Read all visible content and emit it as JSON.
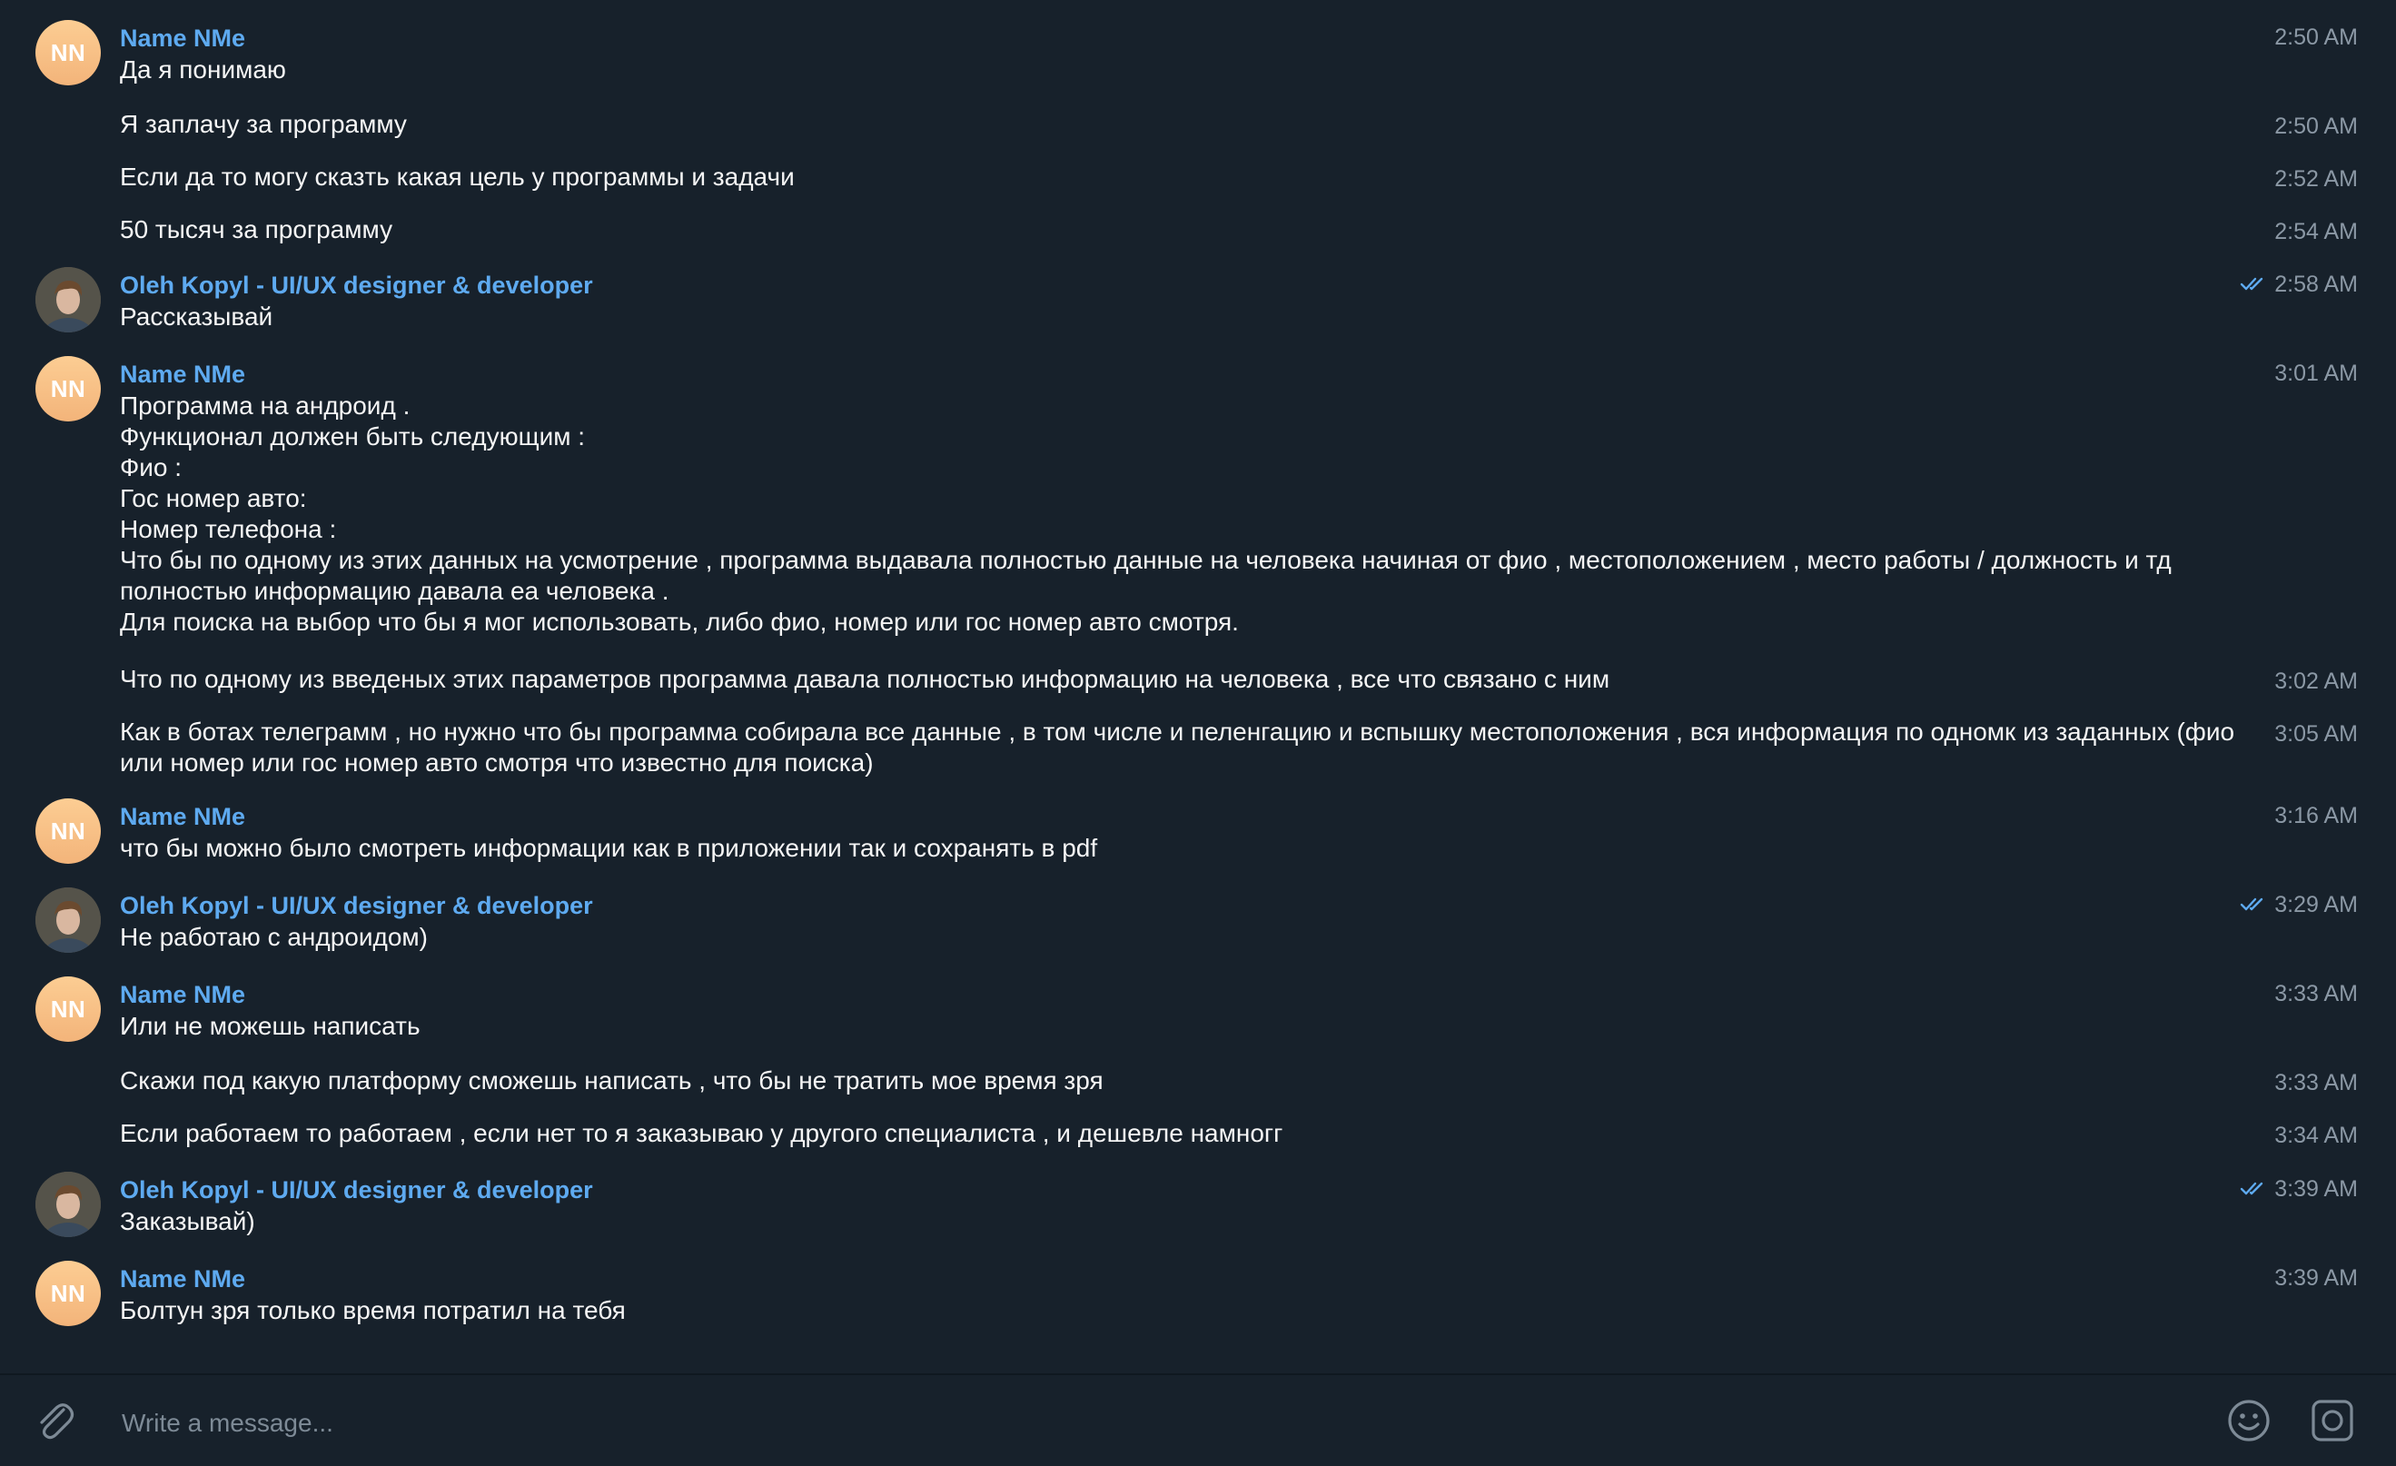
{
  "colors": {
    "background": "#17212b",
    "author": "#5eaaf0",
    "text": "#f5f5f5",
    "time": "#8b98a5",
    "read_check": "#5eaaf0",
    "avatar_gradient_top": "#fccd93",
    "avatar_gradient_bottom": "#f3b47a"
  },
  "messages": [
    {
      "author": "Name NMe",
      "avatar": "NN",
      "time": "2:50 AM",
      "text": "Да я понимаю"
    },
    {
      "author": "",
      "avatar": "",
      "time": "2:50 AM",
      "text": "Я заплачу за программу"
    },
    {
      "author": "",
      "avatar": "",
      "time": "2:52 AM",
      "text": "Если да то могу сказть какая цель у программы и задачи"
    },
    {
      "author": "",
      "avatar": "",
      "time": "2:54 AM",
      "text": "50 тысяч за программу"
    },
    {
      "author": "Oleh Kopyl - UI/UX designer & developer",
      "avatar": "photo",
      "time": "2:58 AM",
      "read": true,
      "text": "Рассказывай"
    },
    {
      "author": "Name NMe",
      "avatar": "NN",
      "time": "3:01 AM",
      "text": "Программа на андроид .\nФункционал должен быть следующим :\nФио :\nГос номер авто:\nНомер телефона :\nЧто бы по одному из этих данных на усмотрение , программа выдавала полностью данные на человека начиная от фио , местоположением , место работы / должность и тд полностью информацию давала еа человека .\nДля поиска на выбор что бы я мог использовать, либо фио, номер или гос номер авто смотря."
    },
    {
      "author": "",
      "avatar": "",
      "time": "3:02 AM",
      "text": "Что по одному из введеных этих параметров программа давала полностью информацию на человека , все что связано с ним"
    },
    {
      "author": "",
      "avatar": "",
      "time": "3:05 AM",
      "text": "Как в ботах телеграмм , но нужно что бы программа собирала все данные , в том числе и пеленгацию и вспышку местоположения , вся информация по одномк из заданных (фио или номер или гос номер авто смотря что известно для поиска)"
    },
    {
      "author": "Name NMe",
      "avatar": "NN",
      "time": "3:16 AM",
      "text": "что бы можно было смотреть информации как в приложении так и сохранять в pdf"
    },
    {
      "author": "Oleh Kopyl - UI/UX designer & developer",
      "avatar": "photo",
      "time": "3:29 AM",
      "read": true,
      "text": "Не работаю с андроидом)"
    },
    {
      "author": "Name NMe",
      "avatar": "NN",
      "time": "3:33 AM",
      "text": "Или не можешь написать"
    },
    {
      "author": "",
      "avatar": "",
      "time": "3:33 AM",
      "text": "Скажи под какую платформу сможешь написать , что бы не тратить мое время зря"
    },
    {
      "author": "",
      "avatar": "",
      "time": "3:34 AM",
      "text": "Если работаем то работаем , если нет то я заказываю у другого специалиста , и дешевле намногг"
    },
    {
      "author": "Oleh Kopyl - UI/UX designer & developer",
      "avatar": "photo",
      "time": "3:39 AM",
      "read": true,
      "text": "Заказывай)"
    },
    {
      "author": "Name NMe",
      "avatar": "NN",
      "time": "3:39 AM",
      "text": "Болтун зря только время потратил на тебя"
    }
  ],
  "composer": {
    "placeholder": "Write a message...",
    "attach_icon": "paperclip-icon",
    "emoji_icon": "emoji-icon",
    "bot_commands_icon": "bot-commands-icon"
  }
}
